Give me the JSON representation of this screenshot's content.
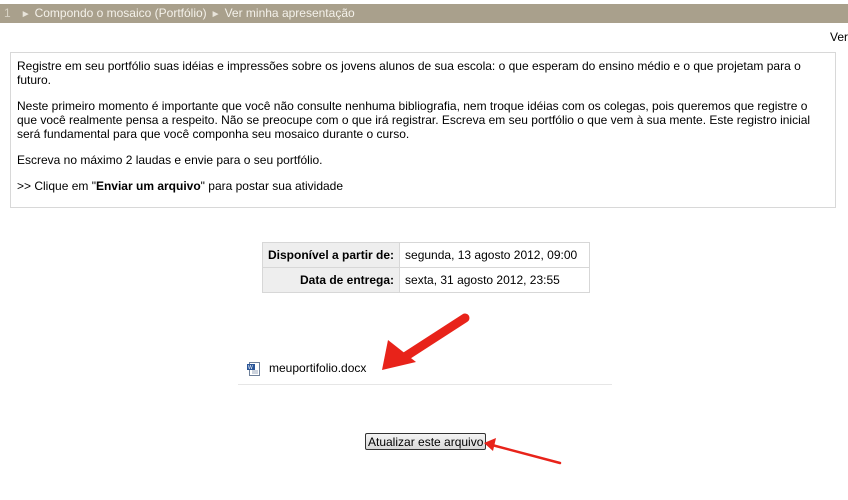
{
  "breadcrumb": {
    "number": "1",
    "items": [
      "Compondo o mosaico (Portfólio)",
      "Ver minha apresentação"
    ]
  },
  "top_right_link": "Ver",
  "intro": {
    "p1": "Registre em seu portfólio suas idéias e impressões sobre os jovens alunos de sua escola: o que esperam do ensino médio e o que projetam para o futuro.",
    "p2": "Neste primeiro momento é importante que você não consulte nenhuma bibliografia, nem troque idéias com os colegas, pois queremos que registre o que você realmente pensa a respeito. Não se preocupe com o que irá registrar. Escreva em seu portfólio o que vem à sua mente. Este registro inicial será fundamental para que você componha seu mosaico durante o curso.",
    "p3": "Escreva no máximo 2 laudas e envie para o seu portfólio.",
    "p4_prefix": ">> Clique em \"",
    "p4_bold": "Enviar um arquivo",
    "p4_suffix": "\" para postar sua atividade"
  },
  "dates": {
    "available_label": "Disponível a partir de:",
    "available_value": "segunda, 13 agosto 2012, 09:00",
    "due_label": "Data de entrega:",
    "due_value": "sexta, 31 agosto 2012, 23:55"
  },
  "file": {
    "name": "meuportifolio.docx",
    "icon": "word-document-icon"
  },
  "update_button": "Atualizar este arquivo",
  "colors": {
    "breadcrumb_bg": "#a9a08c",
    "annotation_arrow": "#e8231a"
  }
}
